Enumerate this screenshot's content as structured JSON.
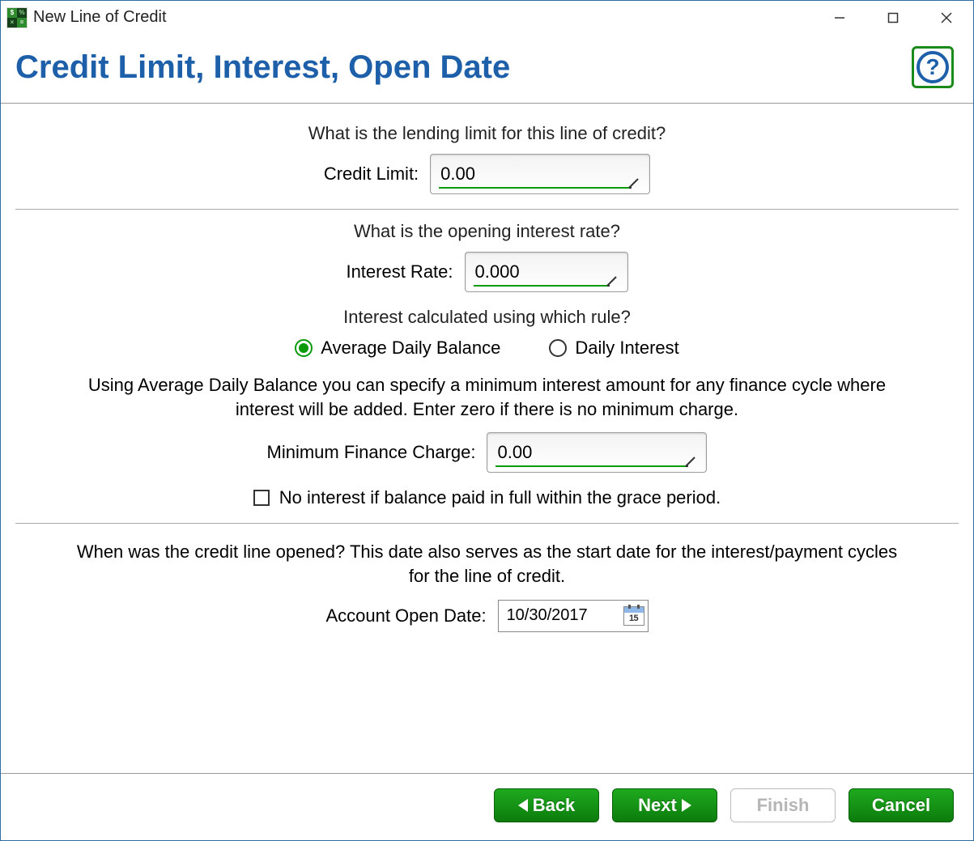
{
  "window": {
    "title": "New Line of Credit"
  },
  "header": {
    "heading": "Credit Limit, Interest, Open Date"
  },
  "section_limit": {
    "question": "What is the lending limit for this line of credit?",
    "label": "Credit Limit:",
    "value": "0.00"
  },
  "section_interest": {
    "question_rate": "What is the opening interest rate?",
    "label_rate": "Interest Rate:",
    "value_rate": "0.000",
    "question_rule": "Interest calculated using which rule?",
    "radio_adb": "Average Daily Balance",
    "radio_daily": "Daily Interest",
    "radio_selected": "adb",
    "explain": "Using Average Daily Balance you can specify a minimum interest amount for any finance cycle where interest will be added. Enter zero if there is no minimum charge.",
    "label_min": "Minimum Finance Charge:",
    "value_min": "0.00",
    "check_label": "No interest if balance paid in full within the grace period.",
    "check_value": false
  },
  "section_open": {
    "question": "When was the credit line opened?  This date also serves as the start date for the interest/payment cycles for the line of credit.",
    "label": "Account Open Date:",
    "value": "10/30/2017",
    "cal_day": "15"
  },
  "footer": {
    "back": "Back",
    "next": "Next",
    "finish": "Finish",
    "cancel": "Cancel"
  }
}
